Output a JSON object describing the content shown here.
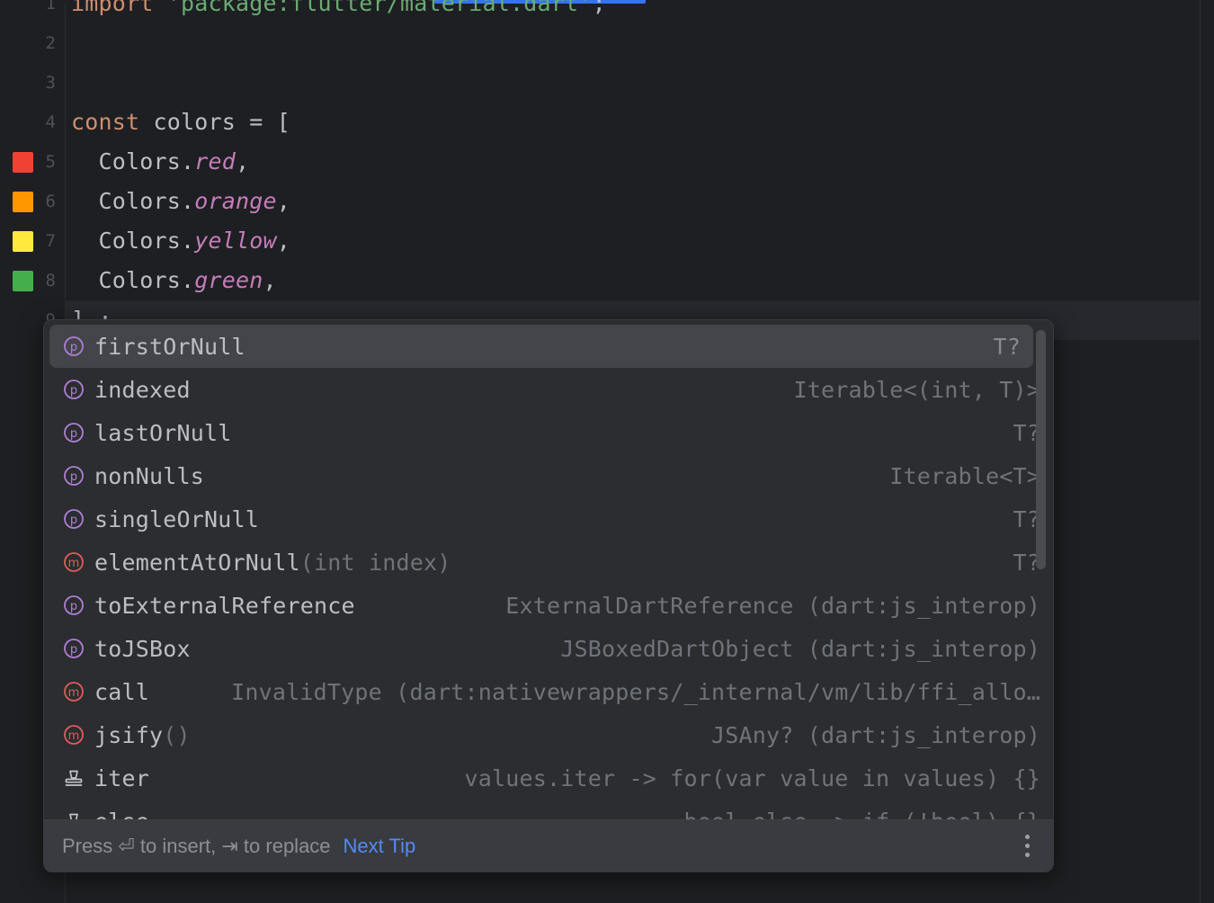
{
  "editor": {
    "language": "dart",
    "lines": [
      {
        "number": "1",
        "tokens": [
          {
            "text": "import ",
            "kind": "kw"
          },
          {
            "text": "'package:flutter/material.dart'",
            "kind": "str"
          },
          {
            "text": ";",
            "kind": "punc"
          }
        ]
      },
      {
        "number": "2",
        "tokens": []
      },
      {
        "number": "3",
        "tokens": []
      },
      {
        "number": "4",
        "tokens": [
          {
            "text": "const ",
            "kind": "kw"
          },
          {
            "text": "colors = [",
            "kind": "plain"
          }
        ]
      },
      {
        "number": "5",
        "swatch": "#F04134",
        "tokens": [
          {
            "text": "  Colors.",
            "kind": "plain"
          },
          {
            "text": "red",
            "kind": "prop"
          },
          {
            "text": ",",
            "kind": "punc"
          }
        ]
      },
      {
        "number": "6",
        "swatch": "#FF9800",
        "tokens": [
          {
            "text": "  Colors.",
            "kind": "plain"
          },
          {
            "text": "orange",
            "kind": "prop"
          },
          {
            "text": ",",
            "kind": "punc"
          }
        ]
      },
      {
        "number": "7",
        "swatch": "#FFE93D",
        "tokens": [
          {
            "text": "  Colors.",
            "kind": "plain"
          },
          {
            "text": "yellow",
            "kind": "prop"
          },
          {
            "text": ",",
            "kind": "punc"
          }
        ]
      },
      {
        "number": "8",
        "swatch": "#45AE4C",
        "tokens": [
          {
            "text": "  Colors.",
            "kind": "plain"
          },
          {
            "text": "green",
            "kind": "prop"
          },
          {
            "text": ",",
            "kind": "punc"
          }
        ]
      },
      {
        "number": "9",
        "current": true,
        "tokens": [
          {
            "text": "].;",
            "kind": "plain"
          }
        ]
      }
    ],
    "colors": {
      "background": "#1E1F22",
      "keyword": "#CF8E6D",
      "string": "#6AAB73",
      "text": "#BCBEC4",
      "static_property": "#C77DBB",
      "current_line": "#26282E",
      "accent": "#3574F0"
    }
  },
  "completion_popup": {
    "selected_index": 0,
    "items": [
      {
        "icon": "property-icon",
        "name": "firstOrNull",
        "params": "",
        "tail": "T?"
      },
      {
        "icon": "property-icon",
        "name": "indexed",
        "params": "",
        "tail": "Iterable<(int, T)>"
      },
      {
        "icon": "property-icon",
        "name": "lastOrNull",
        "params": "",
        "tail": "T?"
      },
      {
        "icon": "property-icon",
        "name": "nonNulls",
        "params": "",
        "tail": "Iterable<T>"
      },
      {
        "icon": "property-icon",
        "name": "singleOrNull",
        "params": "",
        "tail": "T?"
      },
      {
        "icon": "method-icon",
        "name": "elementAtOrNull",
        "params": "(int index)",
        "tail": "T?"
      },
      {
        "icon": "property-icon",
        "name": "toExternalReference",
        "params": "",
        "tail": "ExternalDartReference (dart:js_interop)"
      },
      {
        "icon": "property-icon",
        "name": "toJSBox",
        "params": "",
        "tail": "JSBoxedDartObject (dart:js_interop)"
      },
      {
        "icon": "method-icon",
        "name": "call",
        "params": "",
        "tail": "InvalidType (dart:nativewrappers/_internal/vm/lib/ffi_allo…"
      },
      {
        "icon": "method-icon",
        "name": "jsify",
        "params": "()",
        "tail": "JSAny? (dart:js_interop)"
      },
      {
        "icon": "live-template-icon",
        "name": "iter",
        "params": "",
        "tail": "values.iter -> for(var value in values) {}"
      },
      {
        "icon": "live-template-icon",
        "name": "else",
        "params": "",
        "tail": "bool.else -> if (!bool) {}"
      }
    ],
    "footer": {
      "hint": "Press ⏎ to insert, ⇥ to replace",
      "link": "Next Tip",
      "menu": "more-options"
    },
    "colors": {
      "popup_background": "#2B2D30",
      "selected_row": "#43454A",
      "footer_background": "#393B40",
      "link": "#548AF7",
      "property_icon": "#B07FD8",
      "method_icon": "#E05C5C"
    }
  }
}
